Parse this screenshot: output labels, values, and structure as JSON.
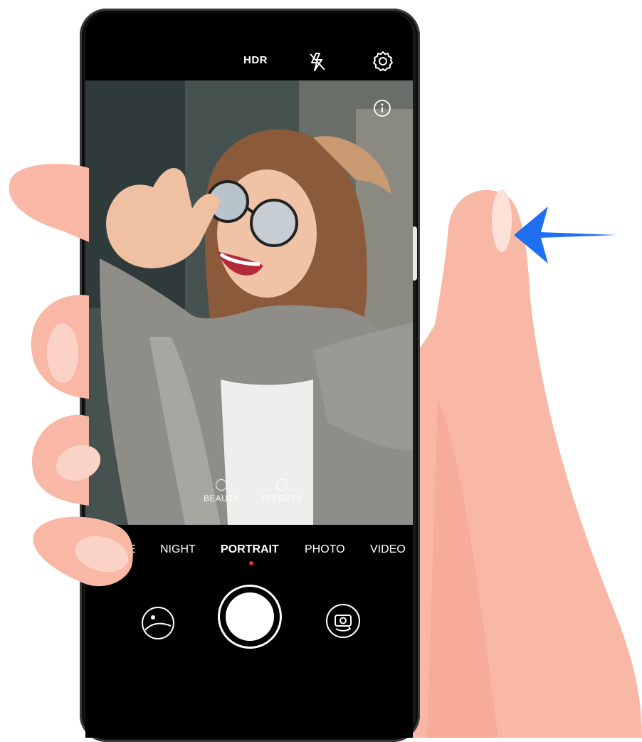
{
  "topbar": {
    "hdr_label": "HDR",
    "flash_icon": "flash-off-icon",
    "settings_icon": "gear-icon"
  },
  "viewfinder": {
    "info_icon": "info-icon",
    "options": [
      {
        "label": "BEAUTY",
        "icon": "beauty-icon"
      },
      {
        "label": "EFFECTS",
        "icon": "effects-icon"
      }
    ]
  },
  "modes": {
    "items": [
      {
        "label": "E"
      },
      {
        "label": "NIGHT"
      },
      {
        "label": "PORTRAIT"
      },
      {
        "label": "PHOTO"
      },
      {
        "label": "VIDEO"
      }
    ],
    "active": "PORTRAIT"
  },
  "controls": {
    "gallery_icon": "gallery-thumbnail-icon",
    "shutter_icon": "shutter-button",
    "switch_icon": "switch-camera-icon"
  },
  "gesture": {
    "arrow_icon": "swipe-left-arrow-icon",
    "arrow_color": "#1f6ff2"
  },
  "colors": {
    "skin": "#f9b8a6",
    "skin_shadow": "#f3a08b",
    "active_dot": "#e53030"
  }
}
